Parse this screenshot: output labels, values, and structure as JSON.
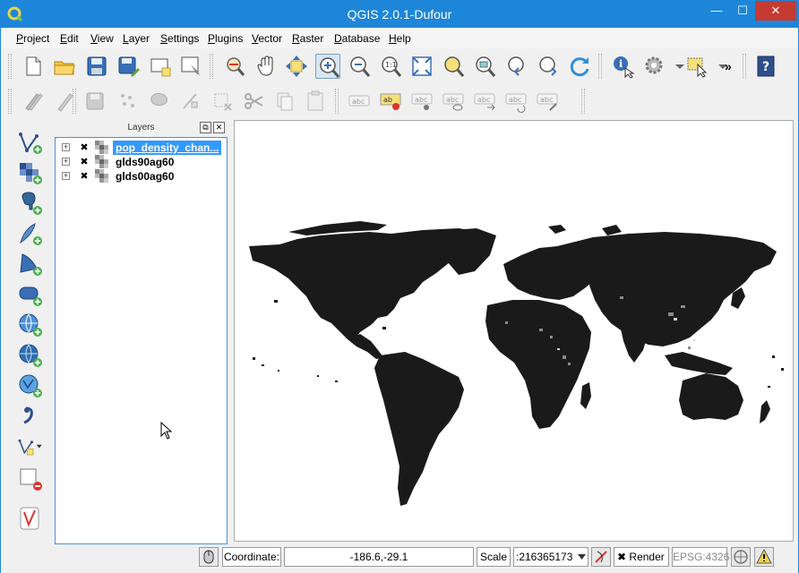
{
  "window": {
    "title": "QGIS 2.0.1-Dufour",
    "minimize": "—",
    "maximize": "☐",
    "close": "✕"
  },
  "menu": [
    {
      "label": "Project",
      "u": "P",
      "rest": "roject"
    },
    {
      "label": "Edit",
      "u": "E",
      "rest": "dit"
    },
    {
      "label": "View",
      "u": "V",
      "rest": "iew"
    },
    {
      "label": "Layer",
      "u": "L",
      "rest": "ayer"
    },
    {
      "label": "Settings",
      "u": "S",
      "rest": "ettings"
    },
    {
      "label": "Plugins",
      "u": "P",
      "rest": "lugins"
    },
    {
      "label": "Vector",
      "u": "V",
      "rest": "ector"
    },
    {
      "label": "Raster",
      "u": "R",
      "rest": "aster"
    },
    {
      "label": "Database",
      "u": "D",
      "rest": "atabase"
    },
    {
      "label": "Help",
      "u": "H",
      "rest": "elp"
    }
  ],
  "toolbar": {
    "overflow": "»"
  },
  "layers_panel": {
    "title": "Layers",
    "float_button": "⧉",
    "close_button": "✕",
    "layers": [
      {
        "name": "pop_density_chan...",
        "checked": "✖",
        "expander": "+"
      },
      {
        "name": "glds90ag60",
        "checked": "✖",
        "expander": "+"
      },
      {
        "name": "glds00ag60",
        "checked": "✖",
        "expander": "+"
      }
    ]
  },
  "statusbar": {
    "coordinate_label": "Coordinate:",
    "coordinate_value": "-186.6,-29.1",
    "scale_label": "Scale",
    "scale_value": ":216365173",
    "render_label": "Render",
    "render_checked": "✖",
    "crs": "EPSG:4326"
  },
  "colors": {
    "titlebar": "#1e86d8",
    "close_button": "#c73a32",
    "selection": "#3399ff",
    "raster_land": "#1a1a1a"
  }
}
